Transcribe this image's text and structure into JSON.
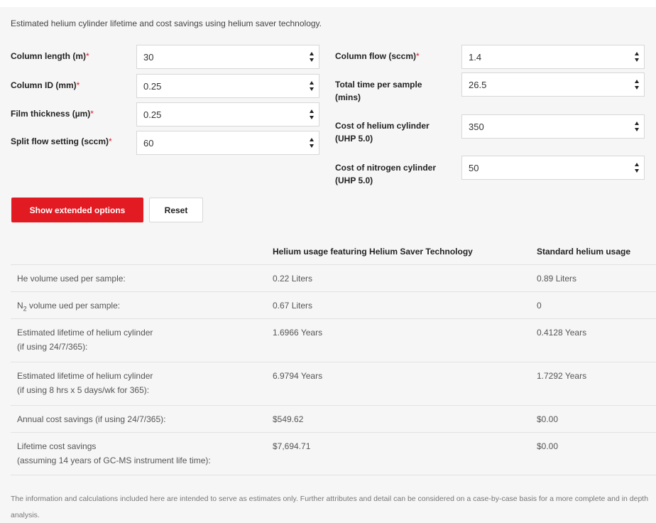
{
  "intro": "Estimated helium cylinder lifetime and cost savings using helium saver technology.",
  "required_mark": "*",
  "fields_left": [
    {
      "label": "Column length (m)",
      "value": "30"
    },
    {
      "label": "Column ID (mm)",
      "value": "0.25"
    },
    {
      "label": "Film thickness (µm)",
      "value": "0.25"
    },
    {
      "label": "Split flow setting (sccm)",
      "value": "60"
    }
  ],
  "fields_right": [
    {
      "label": "Column flow (sccm)",
      "required": true,
      "value": "1.4"
    },
    {
      "label_line1": "Total time per sample",
      "label_line2": "(mins)",
      "value": "26.5"
    },
    {
      "label_line1": "Cost of helium cylinder",
      "label_line2": "(UHP 5.0)",
      "value": "350"
    },
    {
      "label_line1": "Cost of nitrogen cylinder",
      "label_line2": "(UHP 5.0)",
      "value": "50"
    }
  ],
  "buttons": {
    "extended": "Show extended options",
    "reset": "Reset"
  },
  "table": {
    "headers": [
      "Helium usage featuring Helium Saver Technology",
      "Standard helium usage"
    ],
    "rows": [
      {
        "label": "He volume used per sample:",
        "a": "0.22 Liters",
        "b": "0.89 Liters"
      },
      {
        "label_pre": "N",
        "label_sub": "2",
        "label_post": " volume ued per sample:",
        "a": "0.67 Liters",
        "b": "0"
      },
      {
        "label_line1": "Estimated lifetime of helium cylinder",
        "label_line2": "(if using 24/7/365):",
        "a": "1.6966 Years",
        "b": "0.4128 Years"
      },
      {
        "label_line1": "Estimated lifetime of helium cylinder",
        "label_line2": "(if using 8 hrs x 5 days/wk for 365):",
        "a": "6.9794 Years",
        "b": "1.7292 Years"
      },
      {
        "label": "Annual cost savings (if using 24/7/365):",
        "a": "$549.62",
        "b": "$0.00"
      },
      {
        "label_line1": "Lifetime cost savings",
        "label_line2": "(assuming 14 years of GC-MS instrument life time):",
        "a": "$7,694.71",
        "b": "$0.00"
      }
    ]
  },
  "footnote": "The information and calculations included here are intended to serve as estimates only. Further attributes and detail can be considered on a case-by-case basis for a more complete and in depth analysis.",
  "icons": {
    "spinner": "up-down-arrows-icon"
  },
  "colors": {
    "accent": "#e21b23",
    "panel": "#f6f6f6"
  }
}
